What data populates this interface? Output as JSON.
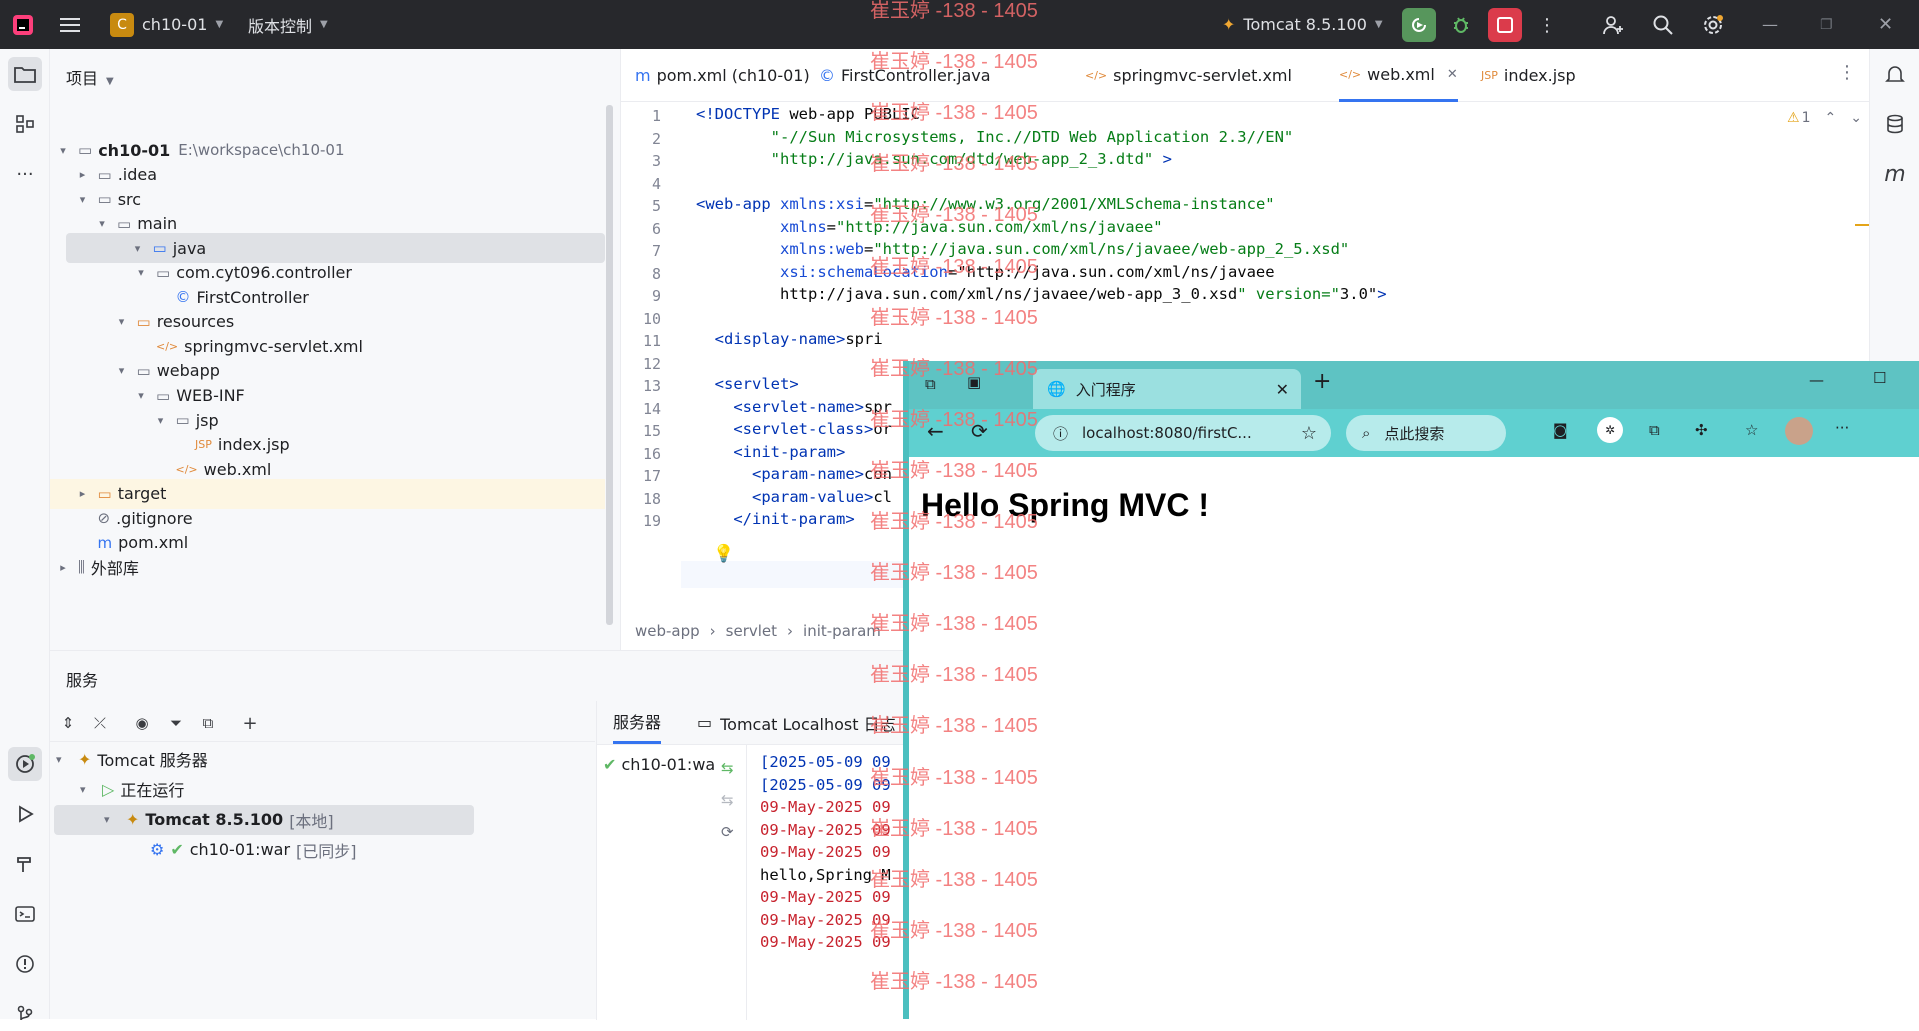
{
  "titlebar": {
    "project_badge": "C",
    "project_name": "ch10-01",
    "vcs_label": "版本控制",
    "run_config": "Tomcat 8.5.100"
  },
  "project_panel": {
    "title": "项目",
    "tree": [
      {
        "label": "ch10-01",
        "hint": "E:\\workspace\\ch10-01",
        "icon": "module-folder-icon",
        "indent": 0,
        "chevron": "down",
        "bold": true
      },
      {
        "label": ".idea",
        "icon": "folder-icon",
        "indent": 1,
        "chevron": "right"
      },
      {
        "label": "src",
        "icon": "folder-icon",
        "indent": 1,
        "chevron": "down"
      },
      {
        "label": "main",
        "icon": "folder-icon",
        "indent": 2,
        "chevron": "down"
      },
      {
        "label": "java",
        "icon": "source-folder-icon",
        "indent": 3,
        "chevron": "down",
        "selected": true
      },
      {
        "label": "com.cyt096.controller",
        "icon": "package-icon",
        "indent": 4,
        "chevron": "down"
      },
      {
        "label": "FirstController",
        "icon": "class-icon",
        "indent": 5,
        "chevron": ""
      },
      {
        "label": "resources",
        "icon": "resources-folder-icon",
        "indent": 3,
        "chevron": "down"
      },
      {
        "label": "springmvc-servlet.xml",
        "icon": "xml-file-icon",
        "indent": 4,
        "chevron": ""
      },
      {
        "label": "webapp",
        "icon": "web-folder-icon",
        "indent": 3,
        "chevron": "down"
      },
      {
        "label": "WEB-INF",
        "icon": "folder-icon",
        "indent": 4,
        "chevron": "down"
      },
      {
        "label": "jsp",
        "icon": "folder-icon",
        "indent": 5,
        "chevron": "down"
      },
      {
        "label": "index.jsp",
        "icon": "jsp-file-icon",
        "indent": 6,
        "chevron": ""
      },
      {
        "label": "web.xml",
        "icon": "web-xml-icon",
        "indent": 5,
        "chevron": ""
      },
      {
        "label": "target",
        "icon": "excluded-folder-icon",
        "indent": 1,
        "chevron": "right",
        "highlight": true
      },
      {
        "label": ".gitignore",
        "icon": "ignore-file-icon",
        "indent": 1,
        "chevron": ""
      },
      {
        "label": "pom.xml",
        "icon": "maven-icon",
        "indent": 1,
        "chevron": ""
      },
      {
        "label": "外部库",
        "icon": "library-icon",
        "indent": 0,
        "chevron": "right"
      }
    ]
  },
  "editor_tabs": [
    {
      "label": "pom.xml (ch10-01)",
      "icon": "maven-icon"
    },
    {
      "label": "FirstController.java",
      "icon": "class-icon"
    },
    {
      "label": "springmvc-servlet.xml",
      "icon": "xml-file-icon"
    },
    {
      "label": "web.xml",
      "icon": "web-xml-icon",
      "active": true
    },
    {
      "label": "index.jsp",
      "icon": "jsp-file-icon"
    }
  ],
  "editor": {
    "warning_count": "1",
    "line_numbers": [
      "1",
      "2",
      "3",
      "4",
      "5",
      "6",
      "7",
      "8",
      "9",
      "10",
      "11",
      "12",
      "13",
      "14",
      "15",
      "16",
      "17",
      "18",
      "19"
    ],
    "lines": [
      "<!DOCTYPE web-app PUBLIC",
      "        \"-//Sun Microsystems, Inc.//DTD Web Application 2.3//EN\"",
      "        \"http://java.sun.com/dtd/web-app_2_3.dtd\" >",
      "",
      "<web-app xmlns:xsi=\"http://www.w3.org/2001/XMLSchema-instance\"",
      "         xmlns=\"http://java.sun.com/xml/ns/javaee\"",
      "         xmlns:web=\"http://java.sun.com/xml/ns/javaee/web-app_2_5.xsd\"",
      "         xsi:schemaLocation=\"http://java.sun.com/xml/ns/javaee",
      "         http://java.sun.com/xml/ns/javaee/web-app_3_0.xsd\" version=\"3.0\">",
      "",
      "  <display-name>spri",
      "",
      "  <servlet>",
      "    <servlet-name>spr",
      "    <servlet-class>or",
      "    <init-param>",
      "      <param-name>con",
      "      <param-value>cl",
      "    </init-param>"
    ],
    "breadcrumb": [
      "web-app",
      "servlet",
      "init-param"
    ]
  },
  "services": {
    "title": "服务",
    "tree": [
      {
        "label": "Tomcat 服务器",
        "icon": "tomcat-icon",
        "indent": 0,
        "chevron": "down"
      },
      {
        "label": "正在运行",
        "icon": "run-icon",
        "indent": 1,
        "chevron": "down"
      },
      {
        "label": "Tomcat 8.5.100",
        "hint": "[本地]",
        "icon": "tomcat-icon",
        "indent": 2,
        "chevron": "down",
        "selected": true,
        "bold": true
      },
      {
        "label": "ch10-01:war",
        "hint": "[已同步]",
        "icon": "artifact-icon",
        "indent": 3,
        "chevron": ""
      }
    ],
    "tabs": [
      "服务器",
      "Tomcat Localhost 日志"
    ],
    "deploy_item": "ch10-01:wa",
    "log": [
      {
        "text": "[2025-05-09 09",
        "color": "#0033b3"
      },
      {
        "text": "[2025-05-09 09",
        "color": "#0033b3"
      },
      {
        "text": "09-May-2025 09",
        "color": "#c7222d"
      },
      {
        "text": "09-May-2025 09",
        "color": "#c7222d"
      },
      {
        "text": "09-May-2025 09",
        "color": "#c7222d"
      },
      {
        "text": "hello,Spring M",
        "color": "#080808"
      },
      {
        "text": "09-May-2025 09",
        "color": "#c7222d"
      },
      {
        "text": "09-May-2025 09",
        "color": "#c7222d"
      },
      {
        "text": "09-May-2025 09",
        "color": "#c7222d"
      }
    ]
  },
  "browser": {
    "tab_title": "入门程序",
    "url": "localhost:8080/firstC...",
    "search_placeholder": "点此搜索",
    "heading": "Hello Spring MVC !"
  },
  "watermark": "崔玉婷 -138 - 1405",
  "colors": {
    "accent": "#3574f0",
    "browser_frame": "#5ec3c3",
    "watermark": "#f26d6d"
  }
}
